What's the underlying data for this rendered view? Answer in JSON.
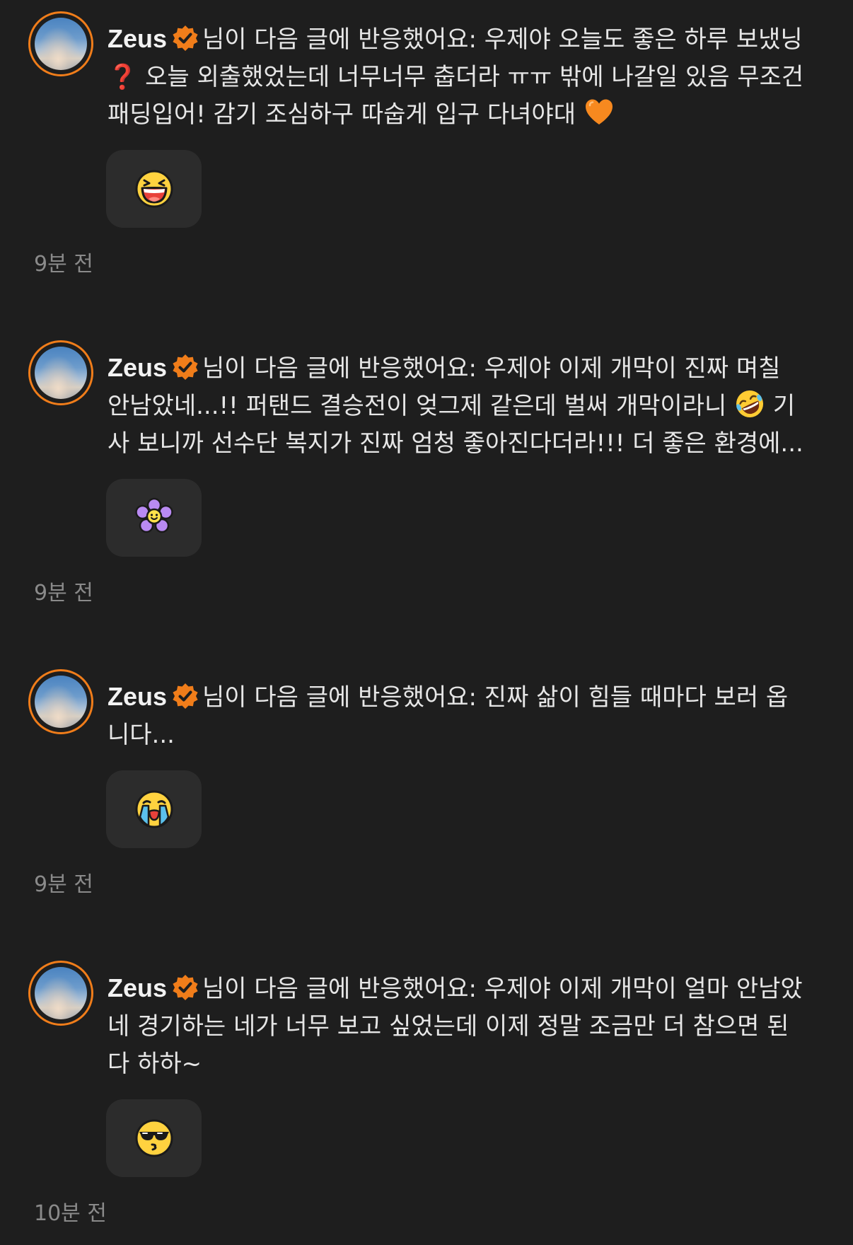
{
  "colors": {
    "background": "#1e1e1e",
    "avatar_ring": "#f07d1a",
    "verified_badge": "#f07d1a",
    "reaction_box": "#2c2c2c",
    "timestamp": "#8a8a8a"
  },
  "notifications": [
    {
      "username": "Zeus",
      "text_before": "님이 다음 글에 반응했어요: 우제야 오늘도 좋은 하루 보냈닝 ",
      "inline_symbol": "❓",
      "text_after": "  오늘 외출했었는데 너무너무 춥더라 ㅠㅠ 밖에 나갈일 있음 무조건 패딩입어! 감기 조심하구 따숩게 입구 다녀야대 ",
      "trailing_emoji": "orange-heart-icon",
      "reaction_icon": "laughing-face-icon",
      "time": "9분 전"
    },
    {
      "username": "Zeus",
      "text_before": "님이 다음 글에 반응했어요: 우제야 이제 개막이 진짜 며칠 안남았네...!! 퍼탠드 결승전이 엊그제 같은데 벌써 개막이라니 ",
      "inline_emoji": "rolling-laughing-face-icon",
      "text_after": " 기사 보니까 선수단 복지가 진짜 엄청 좋아진다더라!!! 더 좋은 환경에...",
      "reaction_icon": "purple-flower-icon",
      "time": "9분 전"
    },
    {
      "username": "Zeus",
      "text_before": "님이 다음 글에 반응했어요: 진짜 삶이 힘들 때마다 보러 옵니다...",
      "reaction_icon": "crying-face-icon",
      "time": "9분 전"
    },
    {
      "username": "Zeus",
      "text_before": "님이 다음 글에 반응했어요: 우제야 이제 개막이 얼마 안남았네 경기하는 네가 너무 보고 싶었는데 이제 정말 조금만 더 참으면 된다 하하~",
      "reaction_icon": "sunglasses-kiss-face-icon",
      "time": "10분 전"
    }
  ]
}
